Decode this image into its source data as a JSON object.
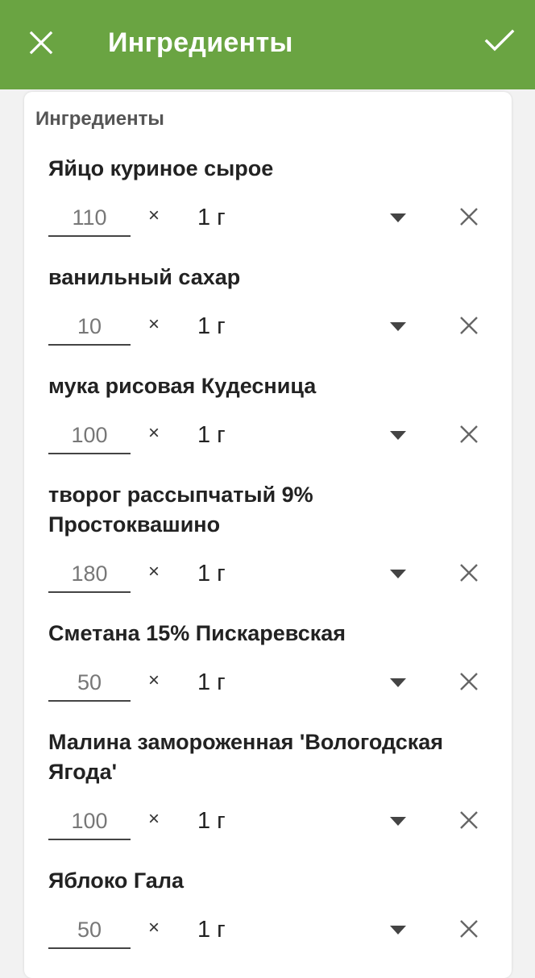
{
  "appbar": {
    "title": "Ингредиенты",
    "color": "#6aa442",
    "close_icon": "close-icon",
    "confirm_icon": "check-icon"
  },
  "section_label": "Ингредиенты",
  "times_symbol": "×",
  "ingredients": [
    {
      "name": "Яйцо куриное сырое",
      "quantity": "110",
      "unit": "1 г"
    },
    {
      "name": "ванильный сахар",
      "quantity": "10",
      "unit": "1 г"
    },
    {
      "name": "мука рисовая Кудесница",
      "quantity": "100",
      "unit": "1 г"
    },
    {
      "name": "творог рассыпчатый 9% Простоквашино",
      "quantity": "180",
      "unit": "1 г"
    },
    {
      "name": "Сметана 15% Пискаревская",
      "quantity": "50",
      "unit": "1 г"
    },
    {
      "name": "Малина замороженная 'Вологодская Ягода'",
      "quantity": "100",
      "unit": "1 г"
    },
    {
      "name": "Яблоко Гала",
      "quantity": "50",
      "unit": "1 г"
    }
  ]
}
